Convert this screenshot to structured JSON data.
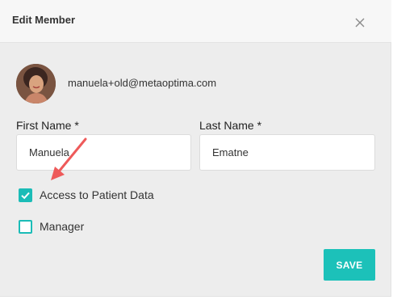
{
  "dialog": {
    "title": "Edit Member",
    "close_icon": "close-icon"
  },
  "member": {
    "email": "manuela+old@metaoptima.com",
    "avatar_icon": "user-avatar"
  },
  "form": {
    "first_name_label": "First Name *",
    "first_name_value": "Manuela",
    "last_name_label": "Last Name *",
    "last_name_value": "Ematne"
  },
  "permissions": [
    {
      "label": "Access to Patient Data",
      "checked": true
    },
    {
      "label": "Manager",
      "checked": false
    }
  ],
  "actions": {
    "save_label": "SAVE"
  },
  "colors": {
    "accent": "#1cc1b9",
    "annotation_arrow": "#ee5a5a"
  }
}
